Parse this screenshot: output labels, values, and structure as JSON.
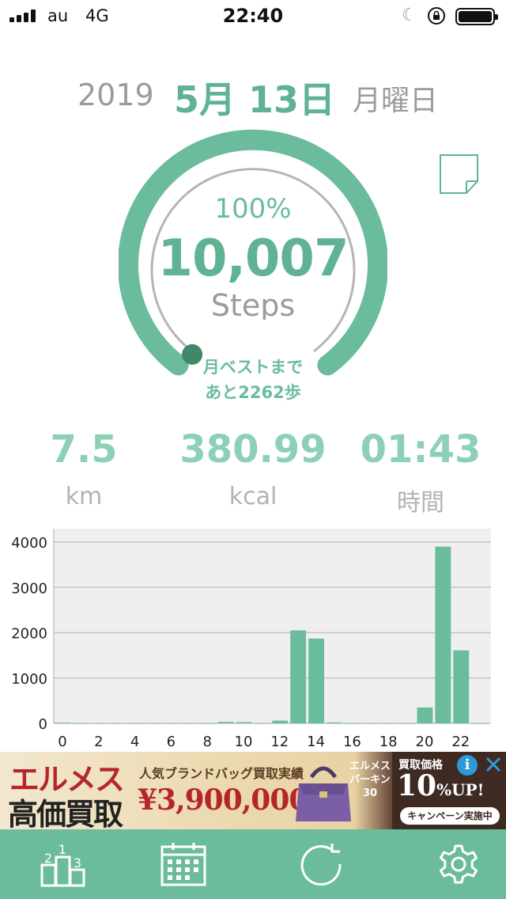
{
  "status_bar": {
    "carrier": "au",
    "network": "4G",
    "time": "22:40",
    "icons": [
      "signal-icon",
      "moon-icon",
      "rotation-lock-icon",
      "battery-icon"
    ]
  },
  "date": {
    "year": "2019",
    "month_day": "5月 13日",
    "weekday": "月曜日"
  },
  "progress": {
    "percent_label": "100%",
    "fraction": 1.0,
    "steps": "10,007",
    "steps_unit": "Steps",
    "best_line1": "月ベストまで",
    "best_line2": "あと2262歩"
  },
  "stats": {
    "distance": {
      "value": "7.5",
      "unit": "km"
    },
    "calories": {
      "value": "380.99",
      "unit": "kcal"
    },
    "duration": {
      "value": "01:43",
      "unit": "時間"
    }
  },
  "colors": {
    "accent": "#5fb393",
    "accent_light": "#8dd0b6",
    "tab_bar": "#6bbc9c",
    "bar": "#6bbc9c",
    "ring_marker": "#3f8a66"
  },
  "chart_data": {
    "type": "bar",
    "x": [
      0,
      1,
      2,
      3,
      4,
      5,
      6,
      7,
      8,
      9,
      10,
      11,
      12,
      13,
      14,
      15,
      16,
      17,
      18,
      19,
      20,
      21,
      22,
      23
    ],
    "x_tick_labels": [
      "0",
      "2",
      "4",
      "6",
      "8",
      "10",
      "12",
      "14",
      "16",
      "18",
      "20",
      "22"
    ],
    "values": [
      15,
      0,
      0,
      0,
      0,
      0,
      0,
      0,
      0,
      30,
      25,
      0,
      60,
      2050,
      1870,
      20,
      0,
      0,
      0,
      0,
      350,
      3900,
      1610,
      0
    ],
    "y_tick_labels": [
      "0",
      "1000",
      "2000",
      "3000",
      "4000"
    ],
    "ylim": [
      0,
      4000
    ],
    "grid": true
  },
  "ad": {
    "headline1": "エルメス",
    "headline2": "高価買取",
    "sub": "人気ブランドバッグ買取実績",
    "price": "¥3,900,000",
    "bag_tag": [
      "エルメス",
      "バーキン",
      "30"
    ],
    "right_top": "買取価格",
    "right_big": "10",
    "right_big_suffix": "%UP!",
    "right_cta": "キャンペーン実施中",
    "info": "i"
  },
  "tab_bar": {
    "items": [
      "ranking-icon",
      "calendar-icon",
      "refresh-icon",
      "settings-icon"
    ],
    "ranking_digits": [
      "1",
      "2",
      "3"
    ]
  }
}
